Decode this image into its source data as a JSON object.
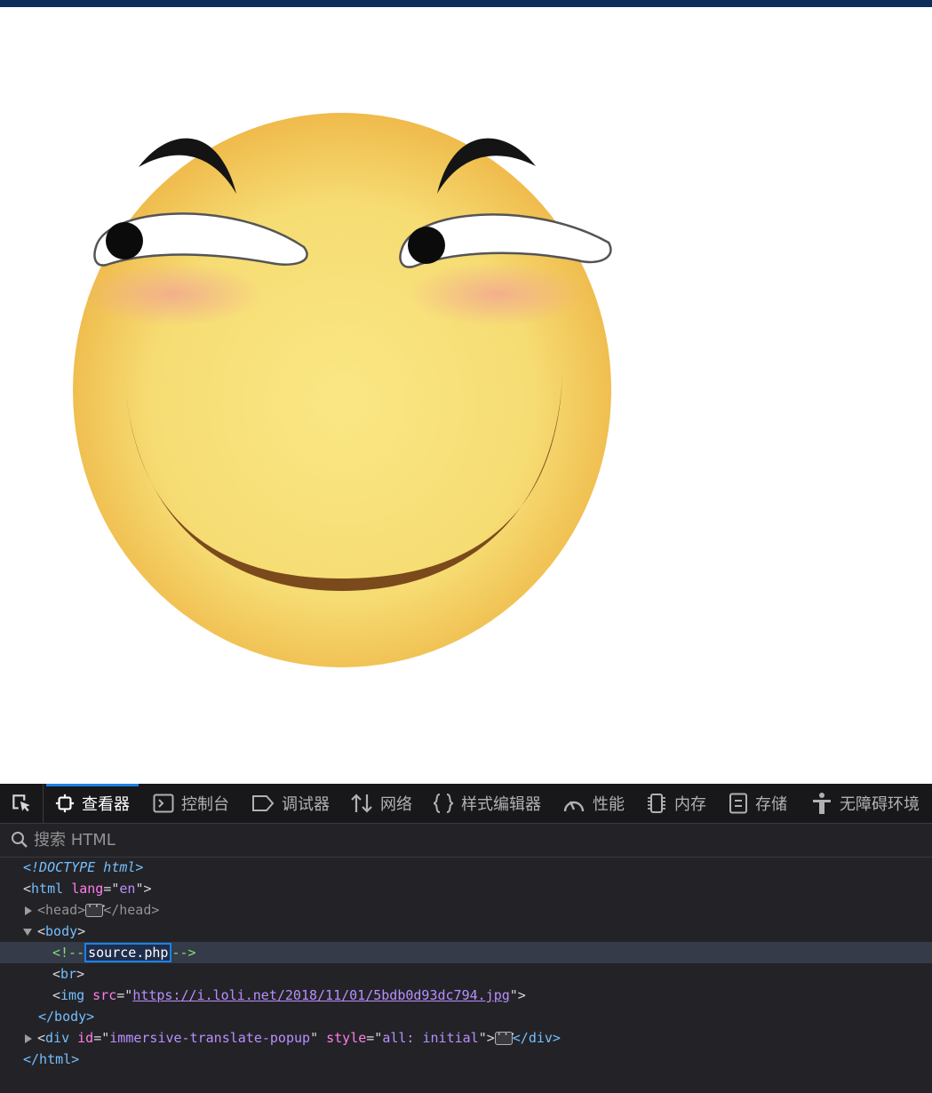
{
  "devtools": {
    "tabs": [
      {
        "label": "查看器",
        "icon": "inspector-icon",
        "active": true
      },
      {
        "label": "控制台",
        "icon": "console-icon"
      },
      {
        "label": "调试器",
        "icon": "debugger-icon"
      },
      {
        "label": "网络",
        "icon": "network-icon"
      },
      {
        "label": "样式编辑器",
        "icon": "style-editor-icon"
      },
      {
        "label": "性能",
        "icon": "performance-icon"
      },
      {
        "label": "内存",
        "icon": "memory-icon"
      },
      {
        "label": "存储",
        "icon": "storage-icon"
      },
      {
        "label": "无障碍环境",
        "icon": "accessibility-icon"
      }
    ],
    "search": {
      "placeholder": "搜索 HTML"
    },
    "tree": {
      "doctype": "<!DOCTYPE html>",
      "html_open": {
        "tag": "html",
        "attr": "lang",
        "value": "en"
      },
      "head": {
        "tag": "head",
        "close": "</head>"
      },
      "body_open": "body",
      "comment": {
        "open": "<!--",
        "text": "source.php",
        "close": "-->"
      },
      "br": "br",
      "img": {
        "tag": "img",
        "attr": "src",
        "value": "https://i.loli.net/2018/11/01/5bdb0d93dc794.jpg"
      },
      "body_close": "</body>",
      "div": {
        "tag": "div",
        "attr1": "id",
        "value1": "immersive-translate-popup",
        "attr2": "style",
        "value2": "all: initial",
        "close": "</div>"
      },
      "html_close": "</html>"
    }
  },
  "colors": {
    "accent": "#1a83e8",
    "panel_bg": "#232327",
    "emoji_face": "#f7d86e"
  }
}
